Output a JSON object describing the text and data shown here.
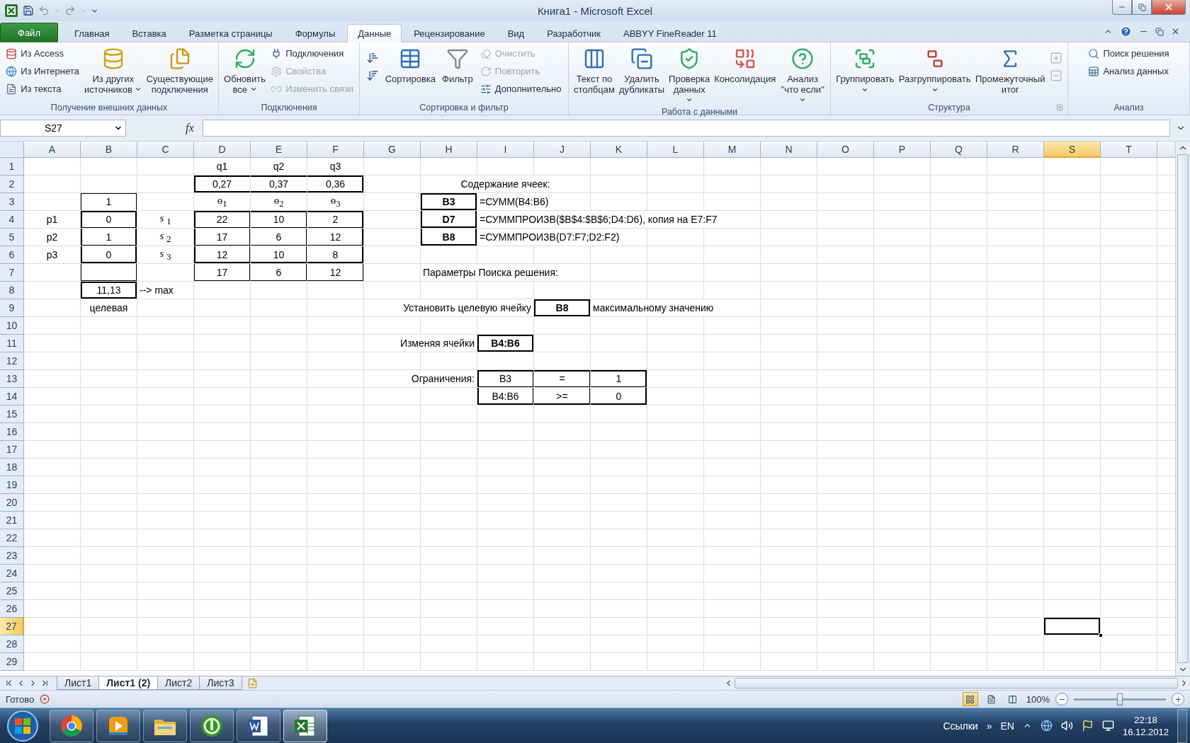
{
  "title_bar": {
    "title": "Книга1 - Microsoft Excel"
  },
  "ribbon_tabs": [
    {
      "label": "Файл",
      "kind": "file",
      "selected": false
    },
    {
      "label": "Главная",
      "kind": "tab",
      "selected": false
    },
    {
      "label": "Вставка",
      "kind": "tab",
      "selected": false
    },
    {
      "label": "Разметка страницы",
      "kind": "tab",
      "selected": false
    },
    {
      "label": "Формулы",
      "kind": "tab",
      "selected": false
    },
    {
      "label": "Данные",
      "kind": "tab",
      "selected": true
    },
    {
      "label": "Рецензирование",
      "kind": "tab",
      "selected": false
    },
    {
      "label": "Вид",
      "kind": "tab",
      "selected": false
    },
    {
      "label": "Разработчик",
      "kind": "tab",
      "selected": false
    },
    {
      "label": "ABBYY FineReader 11",
      "kind": "tab",
      "selected": false
    }
  ],
  "ribbon_groups": [
    {
      "label": "Получение внешних данных",
      "items": [
        {
          "kind": "stack",
          "buttons": [
            {
              "label": "Из Access",
              "disabled": false
            },
            {
              "label": "Из Интернета",
              "disabled": false
            },
            {
              "label": "Из текста",
              "disabled": false
            }
          ]
        },
        {
          "kind": "large",
          "label": "Из других\nисточников",
          "dropdown": true
        },
        {
          "kind": "large",
          "label": "Существующие\nподключения"
        }
      ]
    },
    {
      "label": "Подключения",
      "items": [
        {
          "kind": "large",
          "label": "Обновить\nвсе",
          "dropdown": true
        },
        {
          "kind": "stack",
          "buttons": [
            {
              "label": "Подключения",
              "disabled": false
            },
            {
              "label": "Свойства",
              "disabled": true
            },
            {
              "label": "Изменить связи",
              "disabled": true
            }
          ]
        }
      ]
    },
    {
      "label": "Сортировка и фильтр",
      "items": [
        {
          "kind": "icons",
          "buttons": [
            {
              "disabled": false
            },
            {
              "disabled": false
            }
          ]
        },
        {
          "kind": "large",
          "label": "Сортировка"
        },
        {
          "kind": "large",
          "label": "Фильтр"
        },
        {
          "kind": "stack",
          "buttons": [
            {
              "label": "Очистить",
              "disabled": true
            },
            {
              "label": "Повторить",
              "disabled": true
            },
            {
              "label": "Дополнительно",
              "disabled": false
            }
          ]
        }
      ]
    },
    {
      "label": "Работа с данными",
      "items": [
        {
          "kind": "large",
          "label": "Текст по\nстолбцам"
        },
        {
          "kind": "large",
          "label": "Удалить\nдубликаты"
        },
        {
          "kind": "large",
          "label": "Проверка\nданных",
          "dropdown": true
        },
        {
          "kind": "large",
          "label": "Консолидация"
        },
        {
          "kind": "large",
          "label": "Анализ\n\"что если\"",
          "dropdown": true
        }
      ]
    },
    {
      "label": "Структура",
      "launcher": true,
      "items": [
        {
          "kind": "large",
          "label": "Группировать",
          "dropdown": true
        },
        {
          "kind": "large",
          "label": "Разгруппировать",
          "dropdown": true
        },
        {
          "kind": "large",
          "label": "Промежуточный\nитог"
        },
        {
          "kind": "icons",
          "buttons": [
            {
              "disabled": true
            },
            {
              "disabled": true
            }
          ]
        }
      ]
    },
    {
      "label": "Анализ",
      "items": [
        {
          "kind": "stack",
          "buttons": [
            {
              "label": "Поиск решения",
              "disabled": false
            },
            {
              "label": "Анализ данных",
              "disabled": false
            }
          ]
        }
      ]
    }
  ],
  "formula_bar": {
    "name_box": "S27",
    "fx": "fx"
  },
  "columns": [
    {
      "label": "A",
      "selected": false
    },
    {
      "label": "B",
      "selected": false
    },
    {
      "label": "C",
      "selected": false
    },
    {
      "label": "D",
      "selected": false
    },
    {
      "label": "E",
      "selected": false
    },
    {
      "label": "F",
      "selected": false
    },
    {
      "label": "G",
      "selected": false
    },
    {
      "label": "H",
      "selected": false
    },
    {
      "label": "I",
      "selected": false
    },
    {
      "label": "J",
      "selected": false
    },
    {
      "label": "K",
      "selected": false
    },
    {
      "label": "L",
      "selected": false
    },
    {
      "label": "M",
      "selected": false
    },
    {
      "label": "N",
      "selected": false
    },
    {
      "label": "O",
      "selected": false
    },
    {
      "label": "P",
      "selected": false
    },
    {
      "label": "Q",
      "selected": false
    },
    {
      "label": "R",
      "selected": false
    },
    {
      "label": "S",
      "selected": true
    },
    {
      "label": "T",
      "selected": false
    }
  ],
  "rows": [
    {
      "label": "1",
      "selected": false,
      "cells": [
        {
          "text": "q1",
          "selected": false
        },
        {
          "text": "q2",
          "selected": false
        },
        {
          "text": "q3",
          "selected": false
        }
      ]
    },
    {
      "label": "2",
      "selected": false,
      "cells": [
        {
          "text": "0,27",
          "selected": false
        },
        {
          "text": "0,37",
          "selected": false
        },
        {
          "text": "0,36",
          "selected": false
        },
        {
          "text": "Содержание ячеек:",
          "selected": false
        }
      ]
    },
    {
      "label": "3",
      "selected": false,
      "cells": [
        {
          "text": "1",
          "selected": false
        },
        {
          "text": "ө$_{1}$",
          "serif": true,
          "selected": false
        },
        {
          "text": "ө$_{2}$",
          "serif": true,
          "selected": false
        },
        {
          "text": "ө$_{3}$",
          "serif": true,
          "selected": false
        },
        {
          "text": "B3",
          "bold": true,
          "selected": false
        },
        {
          "text": "=СУММ(B4:B6)",
          "selected": false
        }
      ]
    },
    {
      "label": "4",
      "selected": false,
      "cells": [
        {
          "text": "p1",
          "selected": false
        },
        {
          "text": "0",
          "selected": false
        },
        {
          "text": "*s* $_{1}$",
          "serif": true,
          "selected": false
        },
        {
          "text": "22",
          "selected": false
        },
        {
          "text": "10",
          "selected": false
        },
        {
          "text": "2",
          "selected": false
        },
        {
          "text": "D7",
          "bold": true,
          "selected": false
        },
        {
          "text": "=СУММПРОИЗВ($B$4:$B$6;D4:D6), копия на E7:F7",
          "selected": false
        }
      ]
    },
    {
      "label": "5",
      "selected": false,
      "cells": [
        {
          "text": "p2",
          "selected": false
        },
        {
          "text": "1",
          "selected": false
        },
        {
          "text": "*s* $_{2}$",
          "serif": true,
          "selected": false
        },
        {
          "text": "17",
          "selected": false
        },
        {
          "text": "6",
          "selected": false
        },
        {
          "text": "12",
          "selected": false
        },
        {
          "text": "B8",
          "bold": true,
          "selected": false
        },
        {
          "text": "=СУММПРОИЗВ(D7:F7;D2:F2)",
          "selected": false
        }
      ]
    },
    {
      "label": "6",
      "selected": false,
      "cells": [
        {
          "text": "p3",
          "selected": false
        },
        {
          "text": "0",
          "selected": false
        },
        {
          "text": "*s* $_{3}$",
          "serif": true,
          "selected": false
        },
        {
          "text": "12",
          "selected": false
        },
        {
          "text": "10",
          "selected": false
        },
        {
          "text": "8",
          "selected": false
        }
      ]
    },
    {
      "label": "7",
      "selected": false,
      "cells": [
        {
          "text": "17",
          "selected": false
        },
        {
          "text": "6",
          "selected": false
        },
        {
          "text": "12",
          "selected": false
        },
        {
          "text": "Параметры Поиска решения:",
          "selected": false
        }
      ]
    },
    {
      "label": "8",
      "selected": false,
      "cells": [
        {
          "text": "11,13",
          "selected": false
        },
        {
          "text": "--> max",
          "selected": false
        }
      ]
    },
    {
      "label": "9",
      "selected": false,
      "cells": [
        {
          "text": "целевая",
          "selected": false
        },
        {
          "text": "Установить целевую ячейку",
          "selected": false
        },
        {
          "text": "B8",
          "bold": true,
          "selected": false
        },
        {
          "text": "максимальному значению",
          "selected": false
        }
      ]
    },
    {
      "label": "10",
      "selected": false
    },
    {
      "label": "11",
      "selected": false,
      "cells": [
        {
          "text": "Изменяя ячейки",
          "selected": false
        },
        {
          "text": "B4:B6",
          "bold": true,
          "selected": false
        }
      ]
    },
    {
      "label": "12",
      "selected": false
    },
    {
      "label": "13",
      "selected": false,
      "cells": [
        {
          "text": "Ограничения:",
          "selected": false
        },
        {
          "text": "B3",
          "selected": false
        },
        {
          "text": "=",
          "selected": false
        },
        {
          "text": "1",
          "selected": false
        }
      ]
    },
    {
      "label": "14",
      "selected": false,
      "cells": [
        {
          "text": "B4:B6",
          "selected": false
        },
        {
          "text": ">=",
          "selected": false
        },
        {
          "text": "0",
          "selected": false
        }
      ]
    },
    {
      "label": "15",
      "selected": false
    },
    {
      "label": "16",
      "selected": false
    },
    {
      "label": "17",
      "selected": false
    },
    {
      "label": "18",
      "selected": false
    },
    {
      "label": "19",
      "selected": false
    },
    {
      "label": "20",
      "selected": false
    },
    {
      "label": "21",
      "selected": false
    },
    {
      "label": "22",
      "selected": false
    },
    {
      "label": "23",
      "selected": false
    },
    {
      "label": "24",
      "selected": false
    },
    {
      "label": "25",
      "selected": false
    },
    {
      "label": "26",
      "selected": false
    },
    {
      "label": "27",
      "selected": true,
      "cells": [
        {
          "selected": true
        }
      ]
    },
    {
      "label": "28",
      "selected": false
    },
    {
      "label": "29",
      "selected": false
    }
  ],
  "sheet_tabs": [
    {
      "label": "Лист1",
      "selected": false
    },
    {
      "label": "Лист1 (2)",
      "selected": true
    },
    {
      "label": "Лист2",
      "selected": false
    },
    {
      "label": "Лист3",
      "selected": false
    }
  ],
  "status_bar": {
    "status": "Готово",
    "views": [
      {
        "selected": true
      },
      {
        "selected": false
      },
      {
        "selected": false
      }
    ],
    "zoom": {
      "reading": "100%",
      "level": 0.5
    }
  },
  "taskbar": {
    "apps": [
      {
        "selected": false
      },
      {
        "selected": false
      },
      {
        "selected": false
      },
      {
        "selected": false
      },
      {
        "selected": false
      },
      {
        "selected": true
      }
    ],
    "links": "Ссылки",
    "chevron": "»",
    "language": "EN",
    "time": "22:18",
    "date": "16.12.2012"
  }
}
